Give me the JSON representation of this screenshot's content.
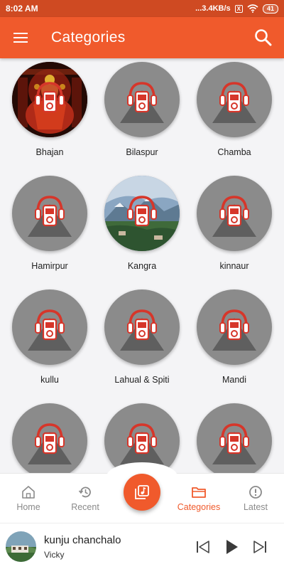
{
  "status_bar": {
    "time": "8:02 AM",
    "net_speed": "...3.4KB/s",
    "sim_badge": "X",
    "battery": "41"
  },
  "app_bar": {
    "title": "Categories",
    "menu_icon": "menu-icon",
    "search_icon": "search-icon"
  },
  "categories": [
    {
      "label": "Bhajan",
      "image": "goddess-photo"
    },
    {
      "label": "Bilaspur",
      "image": "music-player-placeholder"
    },
    {
      "label": "Chamba",
      "image": "music-player-placeholder"
    },
    {
      "label": "Hamirpur",
      "image": "music-player-placeholder"
    },
    {
      "label": "Kangra",
      "image": "mountain-photo"
    },
    {
      "label": "kinnaur",
      "image": "music-player-placeholder"
    },
    {
      "label": "kullu",
      "image": "music-player-placeholder"
    },
    {
      "label": "Lahual & Spiti",
      "image": "music-player-placeholder"
    },
    {
      "label": "Mandi",
      "image": "music-player-placeholder"
    },
    {
      "label": "",
      "image": "music-player-placeholder"
    },
    {
      "label": "",
      "image": "music-player-placeholder"
    },
    {
      "label": "",
      "image": "music-player-placeholder"
    }
  ],
  "bottom_nav": {
    "items": [
      {
        "label": "Home",
        "icon": "home-icon",
        "active": false
      },
      {
        "label": "Recent",
        "icon": "history-icon",
        "active": false
      },
      {
        "label": "Categories",
        "icon": "folder-icon",
        "active": true
      },
      {
        "label": "Latest",
        "icon": "alert-circle-icon",
        "active": false
      }
    ],
    "fab_icon": "music-library-icon"
  },
  "player": {
    "song": "kunju chanchalo",
    "artist": "Vicky"
  },
  "colors": {
    "accent": "#f05a2c",
    "status": "#cf4a22",
    "placeholder": "#8b8b8b"
  }
}
